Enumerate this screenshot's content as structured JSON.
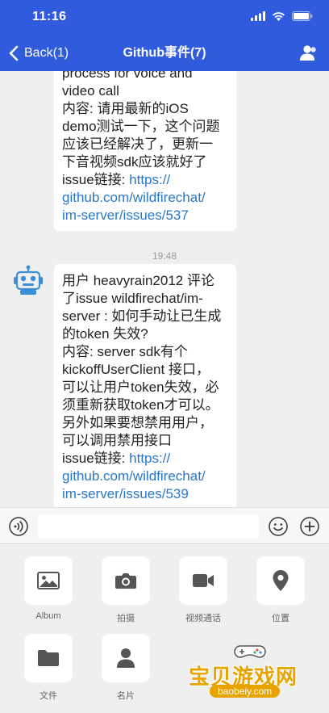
{
  "status_bar": {
    "time": "11:16"
  },
  "nav": {
    "back_label": "Back(1)",
    "title": "Github事件(7)"
  },
  "messages": [
    {
      "lines": [
        "process for voice and",
        "video call",
        "内容: 请用最新的iOS",
        "demo测试一下，这个问题",
        "应该已经解决了，更新一",
        "下音视频sdk应该就好了",
        "issue链接: "
      ],
      "link_lines": [
        "https://",
        "github.com/wildfirechat/",
        "im-server/issues/537"
      ]
    },
    {
      "timestamp": "19:48",
      "lines": [
        "用户 heavyrain2012 评论",
        "了issue wildfirechat/im-",
        "server : 如何手动让已生成",
        "的token 失效?",
        "内容: server sdk有个",
        "kickoffUserClient 接口，",
        "可以让用户token失效，必",
        "须重新获取token才可以。",
        "另外如果要想禁用用户，",
        "可以调用禁用接口",
        "issue链接: "
      ],
      "link_lines": [
        "https://",
        "github.com/wildfirechat/",
        "im-server/issues/539"
      ]
    }
  ],
  "input": {
    "value": ""
  },
  "extensions": [
    {
      "label": "Album",
      "icon": "album-icon"
    },
    {
      "label": "拍摄",
      "icon": "camera-icon"
    },
    {
      "label": "视频通话",
      "icon": "video-call-icon"
    },
    {
      "label": "位置",
      "icon": "location-icon"
    },
    {
      "label": "文件",
      "icon": "folder-icon"
    },
    {
      "label": "名片",
      "icon": "contact-card-icon"
    }
  ],
  "watermark": {
    "text": "宝贝游戏网",
    "url": "baobeiy.com"
  },
  "colors": {
    "nav": "#2f5bdc",
    "link": "#2a77c9",
    "icon": "#555555",
    "watermark": "#e7a300"
  }
}
